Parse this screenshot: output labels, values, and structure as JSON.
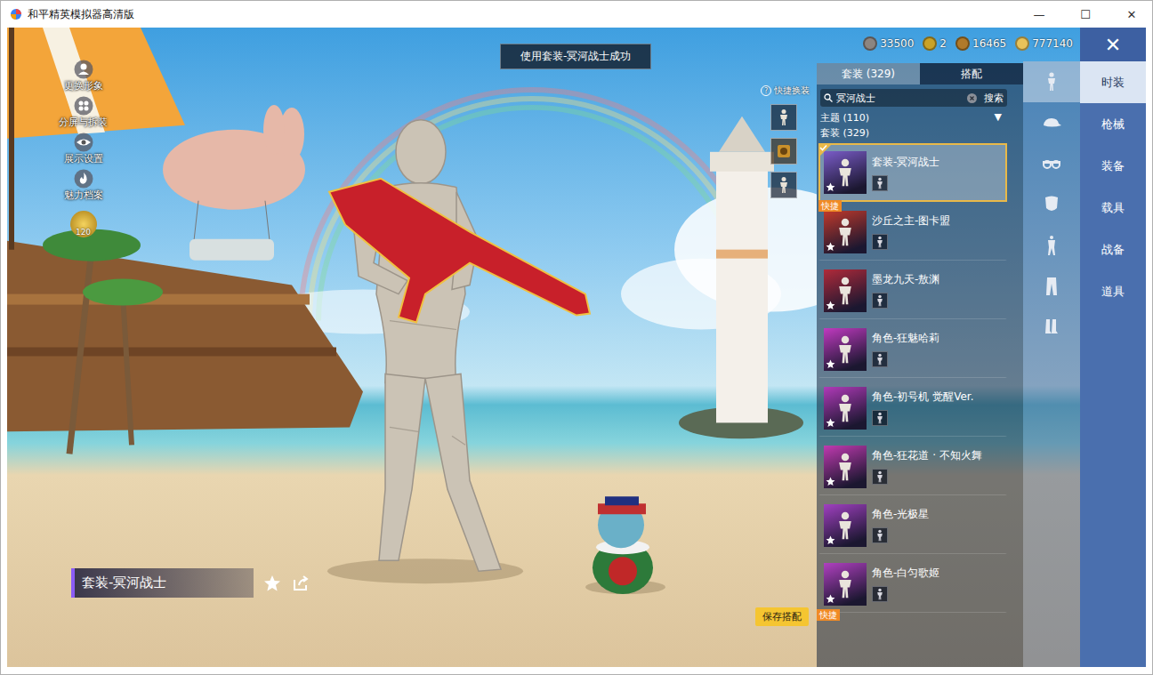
{
  "window": {
    "title": "和平精英模拟器高清版",
    "controls": [
      "—",
      "☐",
      "✕"
    ]
  },
  "toast": "使用套装-冥河战士成功",
  "currencies": [
    {
      "amount": "33500",
      "color": "#8c8580"
    },
    {
      "amount": "2",
      "color": "#c9a227"
    },
    {
      "amount": "16465",
      "color": "#b07a2a"
    },
    {
      "amount": "777140",
      "color": "#e8c35a"
    }
  ],
  "close_button": "✕",
  "side_menu": [
    {
      "label": "更换形象",
      "kind": "person"
    },
    {
      "label": "分屏与拆装",
      "kind": "split"
    },
    {
      "label": "展示设置",
      "kind": "eye"
    },
    {
      "label": "魅力档案",
      "kind": "charm"
    }
  ],
  "level": "120",
  "quick_swap": {
    "label": "快捷换装",
    "help": "?",
    "slots": [
      {
        "kind": "outfit"
      },
      {
        "kind": "emblem"
      },
      {
        "kind": "outfit"
      }
    ]
  },
  "outfit_panel": {
    "tabs": [
      {
        "label": "套装 (329)",
        "selected": true
      },
      {
        "label": "搭配",
        "selected": false
      }
    ],
    "search": {
      "value": "冥河战士",
      "button": "搜索"
    },
    "theme_filter": {
      "label": "主题 (110)",
      "arrow": "▼"
    },
    "group": "套装 (329)",
    "items": [
      {
        "name": "套装-冥河战士",
        "selected": true,
        "equipped": true,
        "badge": null,
        "color": "#7a5cc8"
      },
      {
        "name": "沙丘之主-图卡盟",
        "selected": false,
        "equipped": false,
        "badge": "快捷",
        "color": "#c0392b"
      },
      {
        "name": "墨龙九天-敖渊",
        "selected": false,
        "equipped": false,
        "badge": null,
        "color": "#b02a3a"
      },
      {
        "name": "角色-狂魅哈莉",
        "selected": false,
        "equipped": false,
        "badge": null,
        "color": "#c03ac0"
      },
      {
        "name": "角色-初号机 觉醒Ver.",
        "selected": false,
        "equipped": false,
        "badge": null,
        "color": "#b03ab8"
      },
      {
        "name": "角色-狂花道 · 不知火舞",
        "selected": false,
        "equipped": false,
        "badge": null,
        "color": "#c03ab0"
      },
      {
        "name": "角色-光极星",
        "selected": false,
        "equipped": false,
        "badge": null,
        "color": "#a040c0"
      },
      {
        "name": "角色-白匀歌姬",
        "selected": false,
        "equipped": false,
        "badge": null,
        "color": "#b040c0"
      }
    ],
    "overflow_badge": "快捷"
  },
  "category_icons": [
    {
      "kind": "figure",
      "selected": true
    },
    {
      "kind": "hat",
      "selected": false
    },
    {
      "kind": "goggles",
      "selected": false
    },
    {
      "kind": "mask",
      "selected": false
    },
    {
      "kind": "top",
      "selected": false
    },
    {
      "kind": "pants",
      "selected": false
    },
    {
      "kind": "shoes",
      "selected": false
    }
  ],
  "nav": [
    {
      "label": "时装",
      "selected": true
    },
    {
      "label": "枪械",
      "selected": false
    },
    {
      "label": "装备",
      "selected": false
    },
    {
      "label": "载具",
      "selected": false
    },
    {
      "label": "战备",
      "selected": false
    },
    {
      "label": "道具",
      "selected": false
    }
  ],
  "current_outfit": {
    "name": "套装-冥河战士",
    "favorited": false
  },
  "save_button": "保存搭配"
}
